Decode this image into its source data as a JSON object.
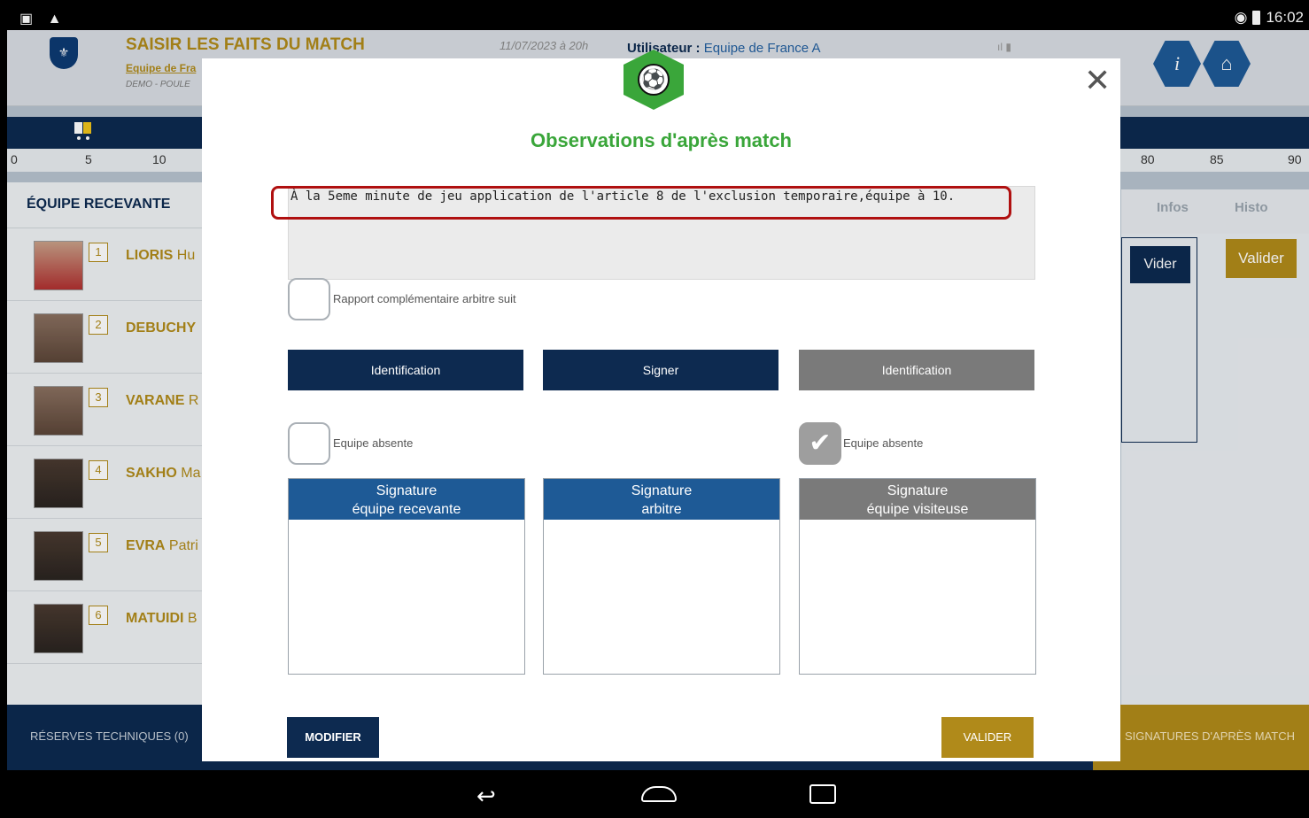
{
  "statusbar": {
    "left_icons": "▣ ▲",
    "wifi": "◉",
    "time": "16:02"
  },
  "header": {
    "title": "SAISIR LES FAITS DU MATCH",
    "team": "Equipe de Fra",
    "demo": "DEMO - POULE",
    "date": "11/07/2023 à 20h",
    "user_label": "Utilisateur :",
    "user_value": "Equipe de France A",
    "info_label": "i",
    "home_label": "⌂"
  },
  "timeline": {
    "ticks_left": [
      "0",
      "5",
      "10"
    ],
    "ticks_right": [
      "80",
      "85",
      "90"
    ]
  },
  "left_panel": {
    "heading": "ÉQUIPE RECEVANTE",
    "players": [
      {
        "num": "1",
        "last": "LIORIS",
        "first": "Hu"
      },
      {
        "num": "2",
        "last": "DEBUCHY",
        "first": ""
      },
      {
        "num": "3",
        "last": "VARANE",
        "first": "R"
      },
      {
        "num": "4",
        "last": "SAKHO",
        "first": "Ma"
      },
      {
        "num": "5",
        "last": "EVRA",
        "first": "Patri"
      },
      {
        "num": "6",
        "last": "MATUIDI",
        "first": "B"
      }
    ]
  },
  "right_panel": {
    "tab_infos": "Infos",
    "tab_histo": "Histo",
    "vider": "Vider",
    "valider": "Valider"
  },
  "bottom_bar": {
    "reserves": "RÉSERVES TECHNIQUES (0)",
    "signatures": "SIGNATURES D'APRÈS MATCH"
  },
  "modal": {
    "title": "Observations d'après match",
    "observation_text": "À la 5eme minute de jeu application de l'article 8 de l'exclusion temporaire,équipe à 10.",
    "rapport_label": "Rapport complémentaire arbitre suit",
    "btn_identification_home": "Identification",
    "btn_signer": "Signer",
    "btn_identification_away": "Identification",
    "equipe_absente_home": "Equipe absente",
    "equipe_absente_away": "Equipe absente",
    "sig_home_line1": "Signature",
    "sig_home_line2": "équipe recevante",
    "sig_ref_line1": "Signature",
    "sig_ref_line2": "arbitre",
    "sig_away_line1": "Signature",
    "sig_away_line2": "équipe visiteuse",
    "modifier": "MODIFIER",
    "valider": "VALIDER",
    "close": "✕"
  },
  "colors": {
    "navy": "#0d2a50",
    "gold": "#b08a1a",
    "green": "#3aa63a",
    "highlight": "#b01010"
  }
}
